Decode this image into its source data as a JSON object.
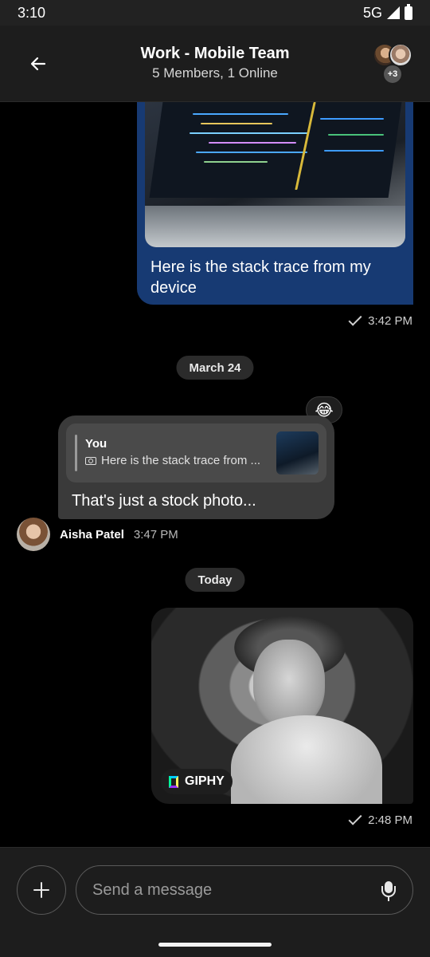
{
  "status_bar": {
    "time": "3:10",
    "network": "5G"
  },
  "header": {
    "title": "Work - Mobile Team",
    "subtitle": "5 Members, 1 Online",
    "extra_members": "+3"
  },
  "messages": {
    "own_photo": {
      "caption": "Here is the stack trace from my device",
      "time": "3:42 PM"
    },
    "date_1": "March 24",
    "reply": {
      "quote_author": "You",
      "quote_text": "Here is the stack trace from ...",
      "text": "That's just a stock photo...",
      "reaction": "😂",
      "sender": "Aisha Patel",
      "time": "3:47 PM"
    },
    "date_2": "Today",
    "own_gif": {
      "badge": "GIPHY",
      "time": "2:48 PM"
    }
  },
  "composer": {
    "placeholder": "Send a message"
  },
  "icons": {
    "back": "arrow-left-icon",
    "add": "plus-icon",
    "mic": "microphone-icon",
    "camera": "camera-icon",
    "check": "check-icon"
  }
}
